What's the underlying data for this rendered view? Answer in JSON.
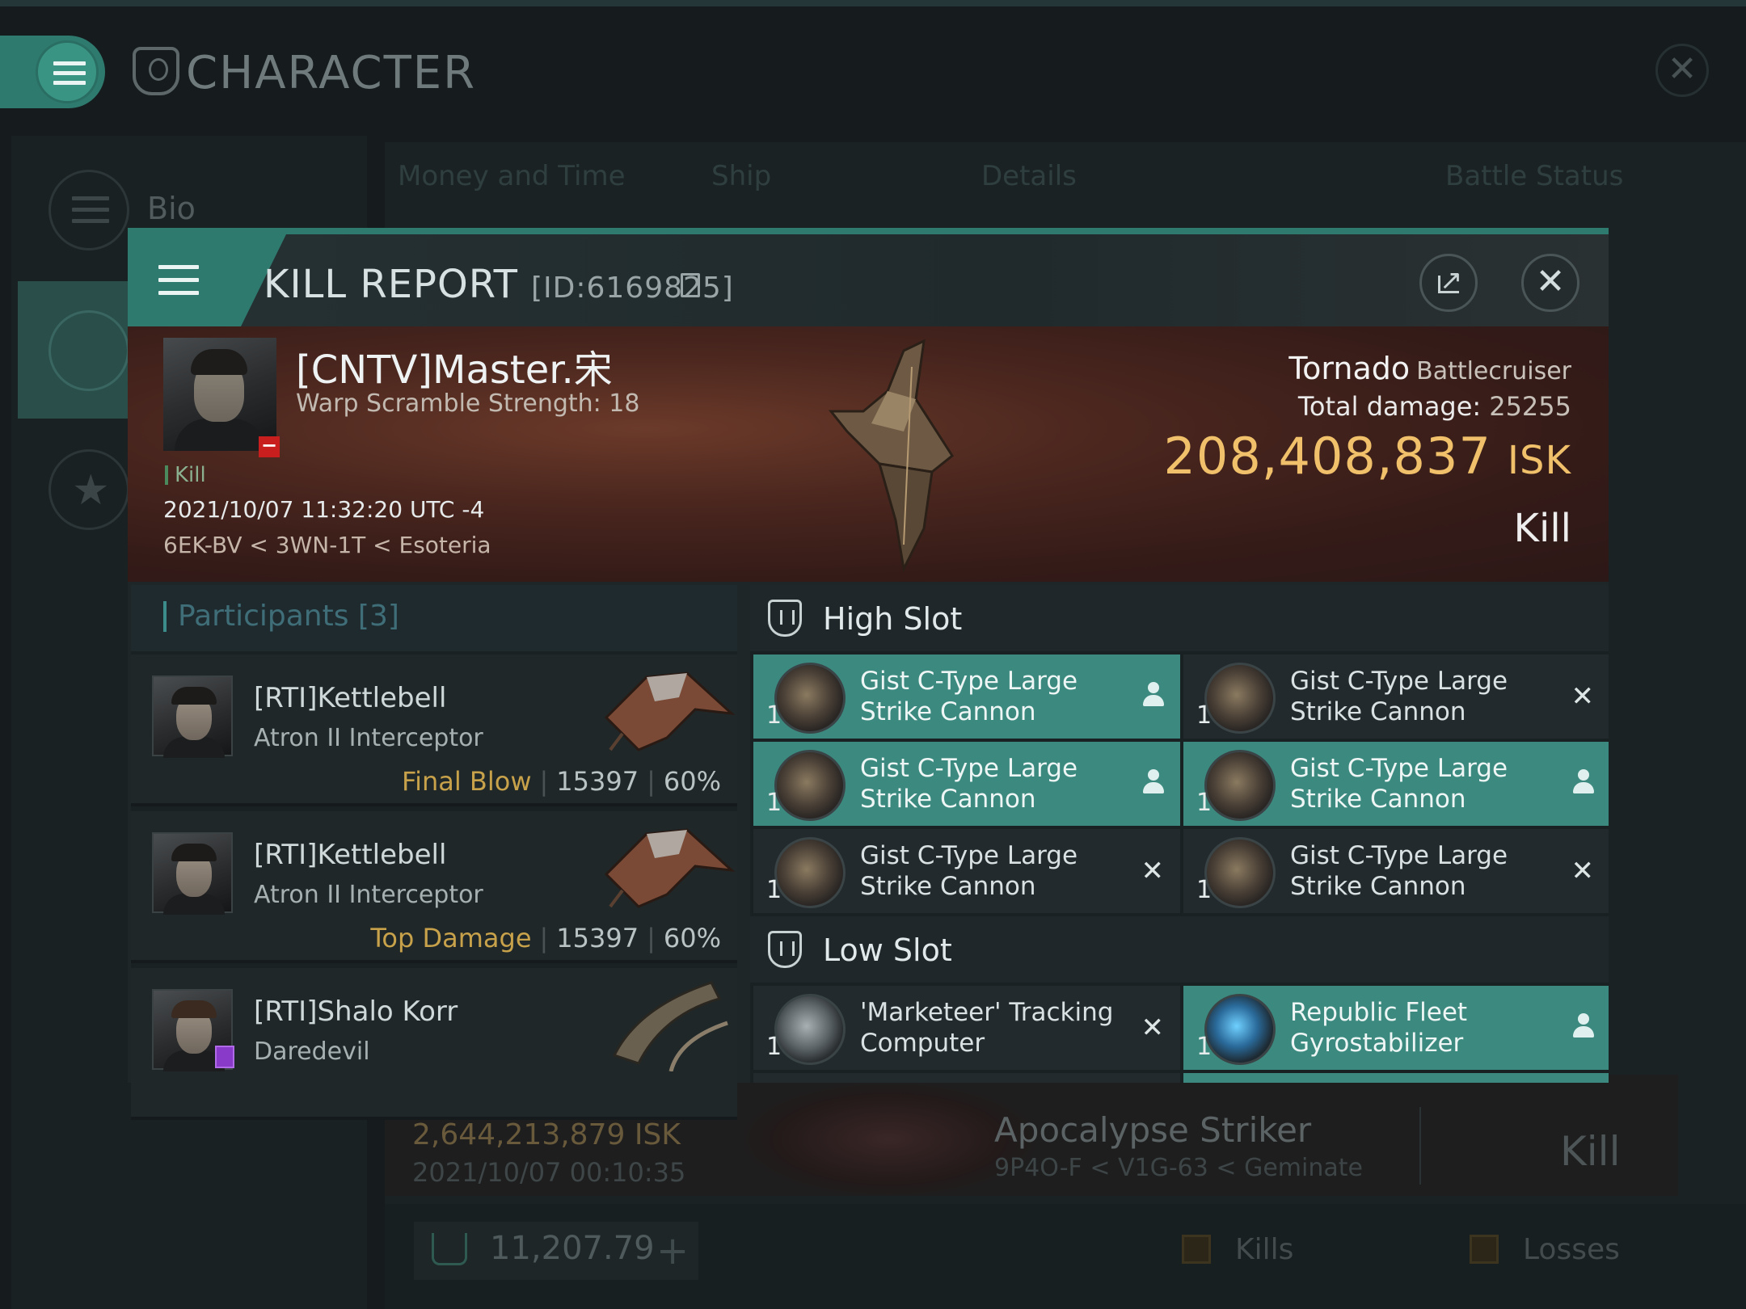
{
  "app": {
    "title": "CHARACTER",
    "sidebar": {
      "bio_label": "Bio"
    },
    "tabs": [
      "Money and Time",
      "Ship",
      "Details",
      "Battle Status"
    ],
    "bg_kill_row": {
      "isk": "2,644,213,879  ISK",
      "date": "2021/10/07  00:10:35",
      "ship": "Apocalypse Striker",
      "location": "9P4O-F < V1G-63 < Geminate",
      "status": "Kill"
    },
    "footer": {
      "wallet_value": "11,207.79",
      "kills_label": "Kills",
      "losses_label": "Losses"
    }
  },
  "kill_report": {
    "title": "KILL REPORT",
    "id": "[ID:6169825]",
    "victim": {
      "name": "[CNTV]Master.宋",
      "scram": "Warp Scramble Strength: 18",
      "kill_tag": "Kill",
      "datetime": "2021/10/07 11:32:20 UTC -4",
      "location": "6EK-BV < 3WN-1T < Esoteria"
    },
    "ship": {
      "name": "Tornado",
      "class": "Battlecruiser",
      "total_damage_label": "Total damage:",
      "total_damage": "25255",
      "isk_value": "208,408,837",
      "isk_unit": "ISK",
      "status": "Kill"
    },
    "participants": {
      "title": "Participants [3]",
      "list": [
        {
          "name": "[RTI]Kettlebell",
          "ship": "Atron II Interceptor",
          "tag": "Final Blow",
          "damage": "15397",
          "percent": "60%"
        },
        {
          "name": "[RTI]Kettlebell",
          "ship": "Atron II Interceptor",
          "tag": "Top Damage",
          "damage": "15397",
          "percent": "60%"
        },
        {
          "name": "[RTI]Shalo Korr",
          "ship": "Daredevil",
          "tag": "",
          "damage": "",
          "percent": ""
        }
      ]
    },
    "fitting": {
      "high_slot_title": "High Slot",
      "low_slot_title": "Low Slot",
      "high": [
        {
          "name": "Gist C-Type Large Strike Cannon",
          "qty": "1",
          "state": "dropped"
        },
        {
          "name": "Gist C-Type Large Strike Cannon",
          "qty": "1",
          "state": "destroyed"
        },
        {
          "name": "Gist C-Type Large Strike Cannon",
          "qty": "1",
          "state": "dropped"
        },
        {
          "name": "Gist C-Type Large Strike Cannon",
          "qty": "1",
          "state": "dropped"
        },
        {
          "name": "Gist C-Type Large Strike Cannon",
          "qty": "1",
          "state": "destroyed"
        },
        {
          "name": "Gist C-Type Large Strike Cannon",
          "qty": "1",
          "state": "destroyed"
        }
      ],
      "low": [
        {
          "name": "'Marketeer' Tracking Computer",
          "qty": "1",
          "state": "destroyed"
        },
        {
          "name": "Republic Fleet Gyrostabilizer",
          "qty": "1",
          "state": "dropped"
        }
      ],
      "destroyed_glyph": "✕"
    }
  }
}
